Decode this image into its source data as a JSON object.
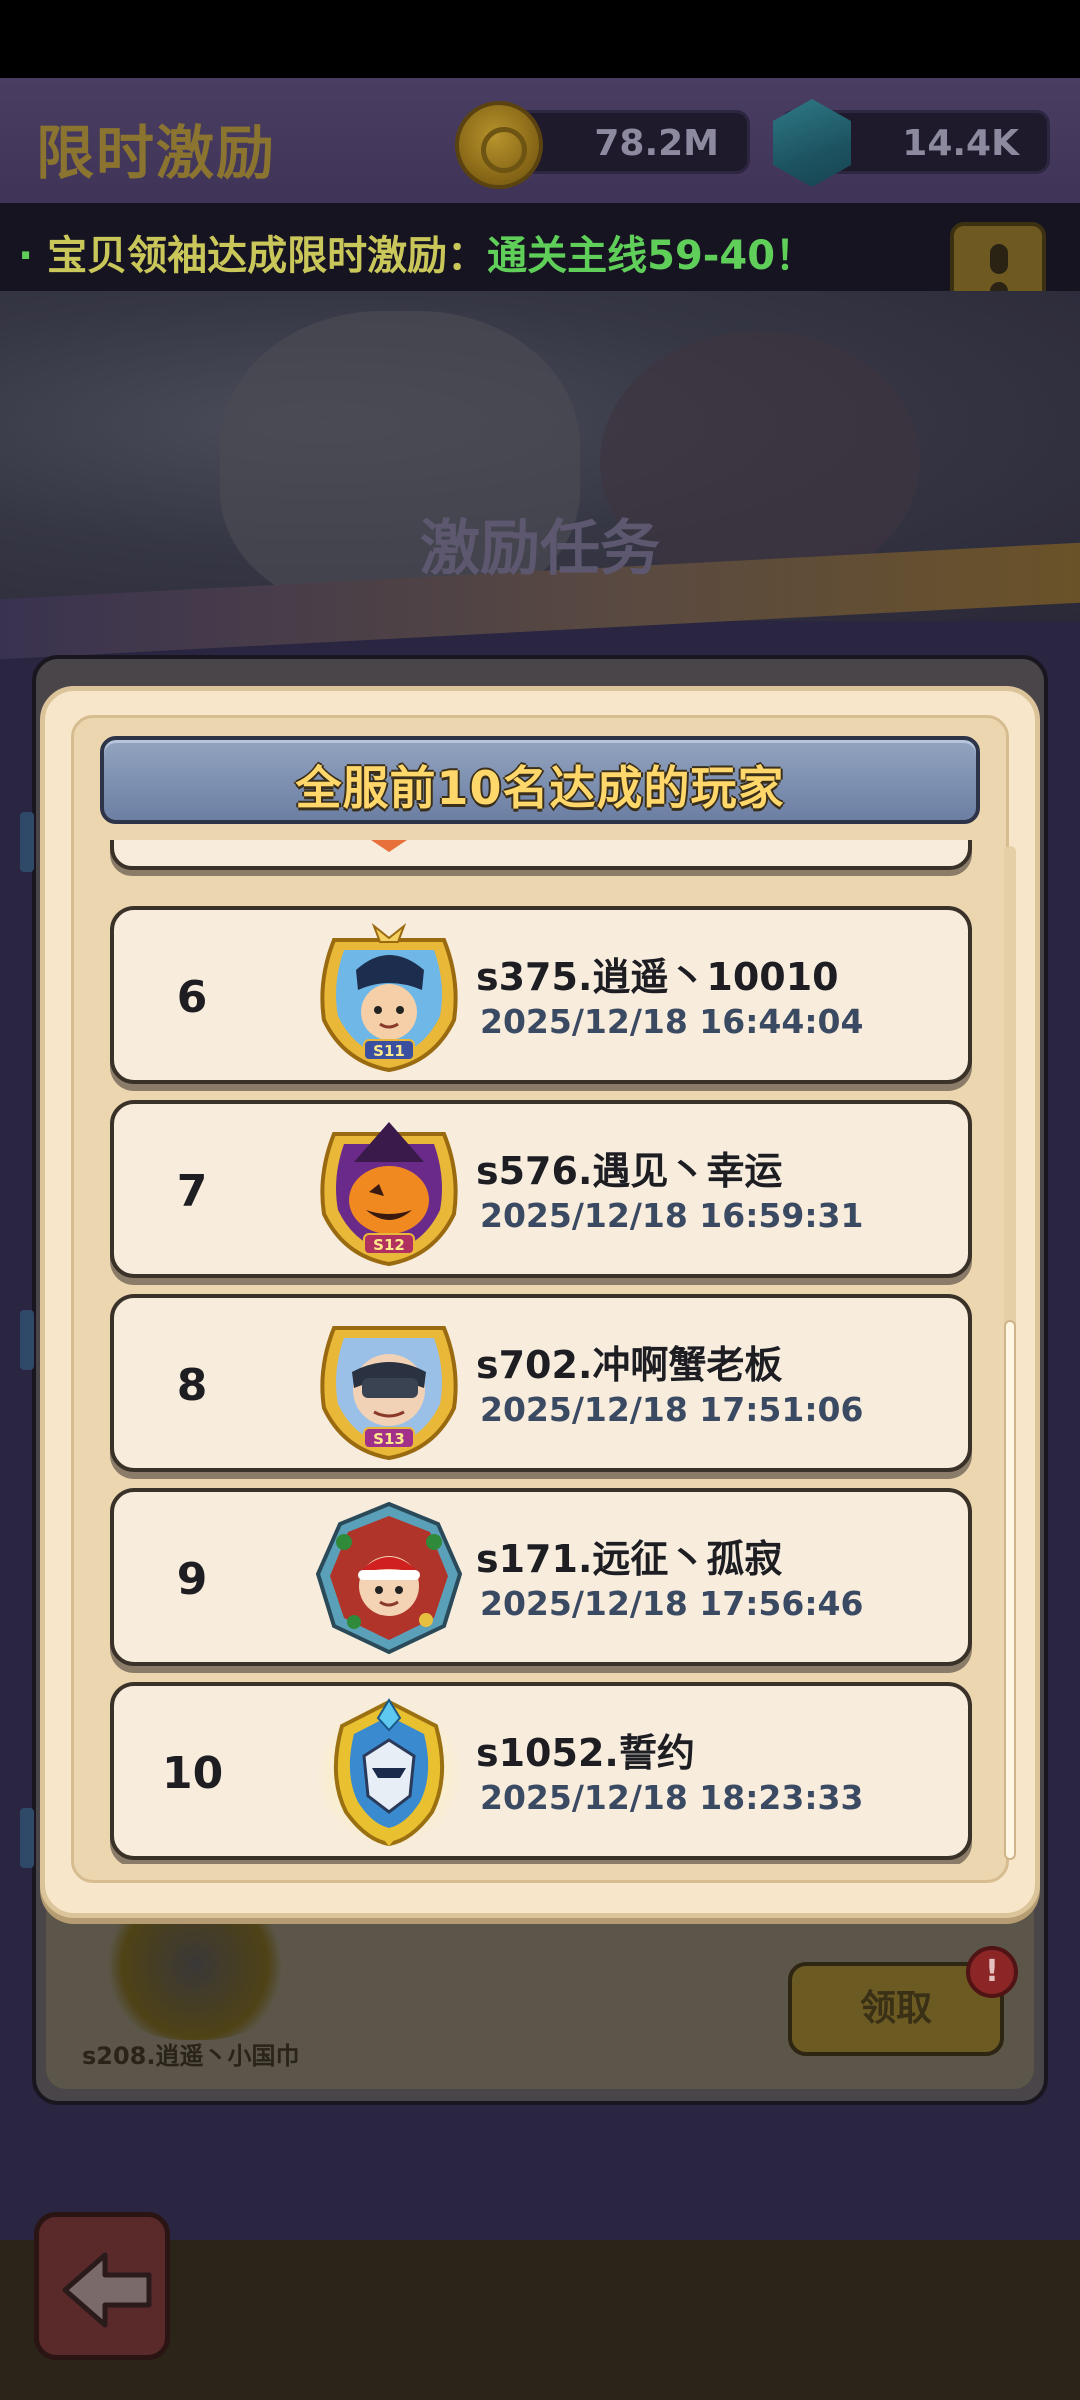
{
  "header": {
    "title": "限时激励",
    "coins": "78.2M",
    "gems": "14.4K"
  },
  "ticker": {
    "prefix": "宝贝领袖达成限时激励：",
    "highlight": "通关主线59-40！"
  },
  "banner": {
    "title": "激励任务"
  },
  "background_panel": {
    "hero_name": "s208.逍遥丶小国巾",
    "claim_label": "领取",
    "alert_badge": "!"
  },
  "modal": {
    "title": "全服前10名达成的玩家",
    "players": [
      {
        "rank": "6",
        "name": "s375.逍遥丶10010",
        "time": "2025/12/18 16:44:04",
        "badge": "S11",
        "avatar": "hero-avatar-icon"
      },
      {
        "rank": "7",
        "name": "s576.遇见丶幸运",
        "time": "2025/12/18 16:59:31",
        "badge": "S12",
        "avatar": "pumpkin-avatar-icon"
      },
      {
        "rank": "8",
        "name": "s702.冲啊蟹老板",
        "time": "2025/12/18 17:51:06",
        "badge": "S13",
        "avatar": "masked-hero-avatar-icon"
      },
      {
        "rank": "9",
        "name": "s171.远征丶孤寂",
        "time": "2025/12/18 17:56:46",
        "badge": "",
        "avatar": "christmas-avatar-icon"
      },
      {
        "rank": "10",
        "name": "s1052.誓约",
        "time": "2025/12/18 18:23:33",
        "badge": "",
        "avatar": "armored-knight-avatar-icon"
      }
    ]
  },
  "colors": {
    "header_text": "#ffd76a",
    "time_text": "#3b4a63",
    "row_bg": "#f8ecdc",
    "modal_bg": "#f7e6c9",
    "frame_gold": "#e9b838"
  }
}
